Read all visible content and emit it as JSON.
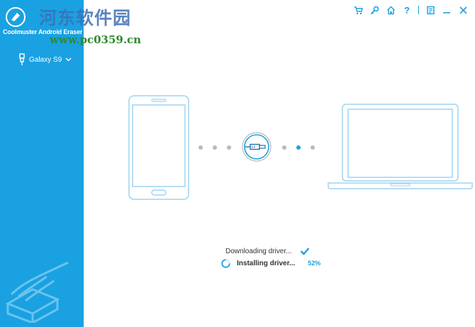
{
  "app": {
    "title": "Coolmuster Android Eraser",
    "watermark_cn": "河东软件园",
    "watermark_url": "www.pc0359.cn"
  },
  "device": {
    "name": "Galaxy S9",
    "icon": "usb-plug-icon",
    "dropdown_icon": "chevron-down-icon"
  },
  "toolbar": {
    "items": [
      {
        "name": "cart-icon"
      },
      {
        "name": "key-icon"
      },
      {
        "name": "home-icon"
      },
      {
        "name": "help-icon",
        "label": "?"
      },
      {
        "name": "feedback-icon"
      },
      {
        "name": "minimize-icon"
      },
      {
        "name": "close-icon"
      }
    ]
  },
  "connection": {
    "source": "phone",
    "target": "computer",
    "connector_icon": "usb-cable-icon"
  },
  "status": {
    "step1": {
      "label": "Downloading driver...",
      "state": "done",
      "icon": "checkmark-icon"
    },
    "step2": {
      "label": "Installing driver...",
      "state": "in-progress",
      "progress": "52%",
      "icon": "spinner-icon"
    }
  },
  "colors": {
    "accent": "#1aa1e2",
    "sidebar": "#1aa1e2",
    "outline": "#9fd3ef",
    "inactive_dot": "#b9b9b9"
  }
}
